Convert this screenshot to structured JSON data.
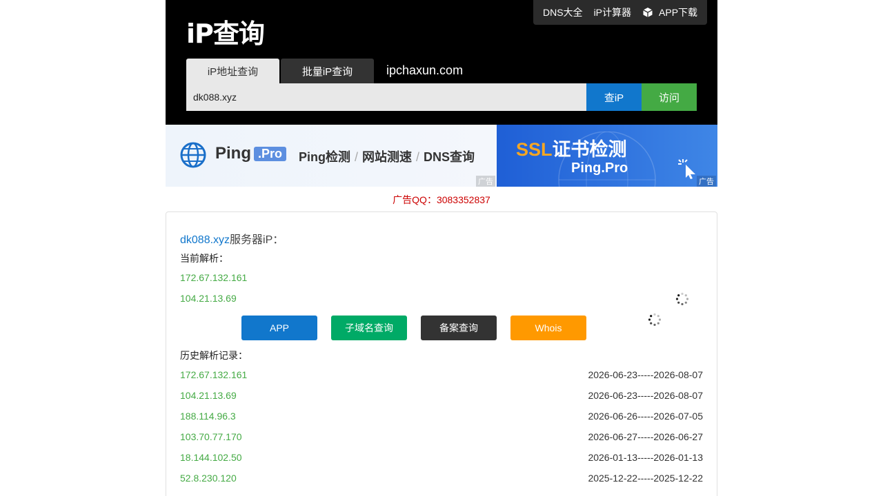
{
  "header": {
    "logo": "iP查询",
    "nav": [
      "DNS大全",
      "iP计算器",
      "APP下载"
    ],
    "tabs": [
      "iP地址查询",
      "批量iP查询"
    ],
    "site": "ipchaxun.com",
    "search_value": "dk088.xyz",
    "query_button": "查iP",
    "visit_button": "访问"
  },
  "ads": {
    "left": {
      "brand": "Ping",
      "brand_badge": ".Pro",
      "services": [
        "Ping检测",
        "网站测速",
        "DNS查询"
      ],
      "tag": "广告"
    },
    "right": {
      "title_accent": "SSL",
      "title": "证书检测",
      "subtitle": "Ping.Pro",
      "tag": "广告"
    },
    "qq": "广告QQ：3083352837"
  },
  "result": {
    "domain": "dk088.xyz",
    "title_suffix": "服务器iP：",
    "current_label": "当前解析：",
    "current_ips": [
      "172.67.132.161",
      "104.21.13.69"
    ],
    "buttons": [
      "APP",
      "子域名查询",
      "备案查询",
      "Whois"
    ],
    "history_label": "历史解析记录：",
    "history": [
      {
        "ip": "172.67.132.161",
        "range": "2026-06-23-----2026-08-07"
      },
      {
        "ip": "104.21.13.69",
        "range": "2026-06-23-----2026-08-07"
      },
      {
        "ip": "188.114.96.3",
        "range": "2026-06-26-----2026-07-05"
      },
      {
        "ip": "103.70.77.170",
        "range": "2026-06-27-----2026-06-27"
      },
      {
        "ip": "18.144.102.50",
        "range": "2026-01-13-----2026-01-13"
      },
      {
        "ip": "52.8.230.120",
        "range": "2025-12-22-----2025-12-22"
      }
    ]
  },
  "colors": {
    "accent_blue": "#1177cc",
    "accent_green": "#44aa44",
    "btn_subdomain": "#00aa66",
    "btn_icp": "#333333",
    "btn_whois": "#ff9900"
  },
  "icons": [
    "cube-icon",
    "globe-icon",
    "cursor-click-icon",
    "loading-spinner-icon"
  ]
}
